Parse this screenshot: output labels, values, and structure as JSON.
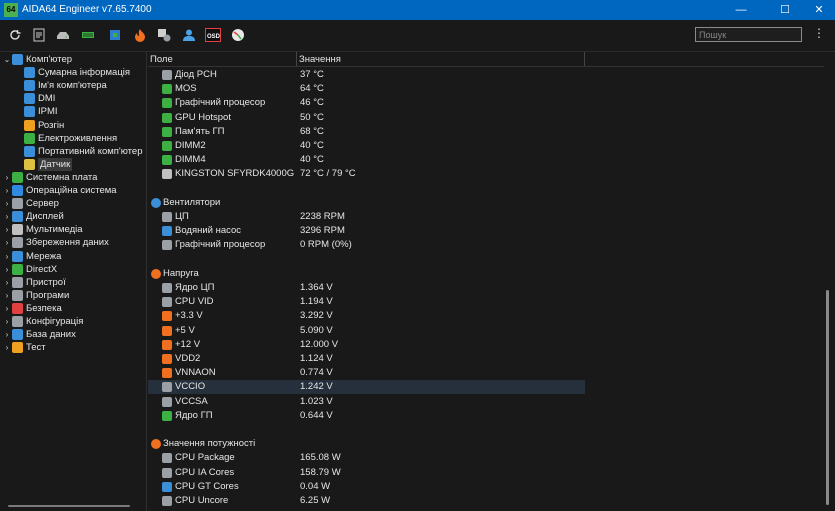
{
  "window": {
    "title": "AIDA64 Engineer v7.65.7400",
    "app_icon": "64"
  },
  "toolbar": {
    "search_placeholder": "Пошук",
    "kebab": "⋮"
  },
  "tree": {
    "items": [
      {
        "label": "Комп'ютер",
        "level": 0,
        "expanded": true,
        "icon": "computer-icon",
        "color": "#3b8fd9"
      },
      {
        "label": "Сумарна інформація",
        "level": 1,
        "icon": "summary-icon",
        "color": "#3b8fd9"
      },
      {
        "label": "Ім'я комп'ютера",
        "level": 1,
        "icon": "computer-name-icon",
        "color": "#3b8fd9"
      },
      {
        "label": "DMI",
        "level": 1,
        "icon": "dmi-icon",
        "color": "#3b8fd9"
      },
      {
        "label": "IPMI",
        "level": 1,
        "icon": "ipmi-icon",
        "color": "#3b8fd9"
      },
      {
        "label": "Розгін",
        "level": 1,
        "icon": "overclock-icon",
        "color": "#f0a020"
      },
      {
        "label": "Електроживлення",
        "level": 1,
        "icon": "power-icon",
        "color": "#3cb043"
      },
      {
        "label": "Портативний комп'ютер",
        "level": 1,
        "icon": "laptop-icon",
        "color": "#3b8fd9"
      },
      {
        "label": "Датчик",
        "level": 1,
        "icon": "sensor-icon",
        "color": "#e0c040",
        "selected": true
      },
      {
        "label": "Системна плата",
        "level": 0,
        "icon": "motherboard-icon",
        "color": "#3cb043"
      },
      {
        "label": "Операційна система",
        "level": 0,
        "icon": "windows-icon",
        "color": "#2f8ae0"
      },
      {
        "label": "Сервер",
        "level": 0,
        "icon": "server-icon",
        "color": "#9aa0a6"
      },
      {
        "label": "Дисплей",
        "level": 0,
        "icon": "display-icon",
        "color": "#3b8fd9"
      },
      {
        "label": "Мультимедіа",
        "level": 0,
        "icon": "multimedia-icon",
        "color": "#c0c0c0"
      },
      {
        "label": "Збереження даних",
        "level": 0,
        "icon": "storage-icon",
        "color": "#9aa0a6"
      },
      {
        "label": "Мережа",
        "level": 0,
        "icon": "network-icon",
        "color": "#3b8fd9"
      },
      {
        "label": "DirectX",
        "level": 0,
        "icon": "directx-icon",
        "color": "#3cb043"
      },
      {
        "label": "Пристрої",
        "level": 0,
        "icon": "devices-icon",
        "color": "#9aa0a6"
      },
      {
        "label": "Програми",
        "level": 0,
        "icon": "programs-icon",
        "color": "#9aa0a6"
      },
      {
        "label": "Безпека",
        "level": 0,
        "icon": "security-icon",
        "color": "#e04040"
      },
      {
        "label": "Конфігурація",
        "level": 0,
        "icon": "config-icon",
        "color": "#9aa0a6"
      },
      {
        "label": "База даних",
        "level": 0,
        "icon": "database-icon",
        "color": "#3b8fd9"
      },
      {
        "label": "Тест",
        "level": 0,
        "icon": "test-icon",
        "color": "#f0a020"
      }
    ]
  },
  "list": {
    "col_field": "Поле",
    "col_value": "Значення",
    "rows": [
      {
        "kind": "item",
        "name": "Діод PCH",
        "value": "37 °C",
        "icon": "pch-icon",
        "color": "#9aa0a6"
      },
      {
        "kind": "item",
        "name": "MOS",
        "value": "64 °C",
        "icon": "mos-icon",
        "color": "#3cb043"
      },
      {
        "kind": "item",
        "name": "Графічний процесор",
        "value": "46 °C",
        "icon": "gpu-icon",
        "color": "#3cb043"
      },
      {
        "kind": "item",
        "name": "GPU Hotspot",
        "value": "50 °C",
        "icon": "gpu-hotspot-icon",
        "color": "#3cb043"
      },
      {
        "kind": "item",
        "name": "Пам'ять ГП",
        "value": "68 °C",
        "icon": "gpu-memory-icon",
        "color": "#3cb043"
      },
      {
        "kind": "item",
        "name": "DIMM2",
        "value": "40 °C",
        "icon": "dimm-icon",
        "color": "#3cb043"
      },
      {
        "kind": "item",
        "name": "DIMM4",
        "value": "40 °C",
        "icon": "dimm-icon",
        "color": "#3cb043"
      },
      {
        "kind": "item",
        "name": "KINGSTON SFYRDK4000G",
        "value": "72 °C / 79 °C",
        "icon": "ssd-icon",
        "color": "#c0c0c0"
      },
      {
        "kind": "blank"
      },
      {
        "kind": "section",
        "name": "Вентилятори",
        "icon": "fan-section-icon",
        "color": "#3b8fd9"
      },
      {
        "kind": "item",
        "name": "ЦП",
        "value": "2238 RPM",
        "icon": "cpu-fan-icon",
        "color": "#9aa0a6"
      },
      {
        "kind": "item",
        "name": "Водяний насос",
        "value": "3296 RPM",
        "icon": "pump-icon",
        "color": "#3b8fd9"
      },
      {
        "kind": "item",
        "name": "Графічний процесор",
        "value": "0 RPM  (0%)",
        "icon": "gpu-fan-icon",
        "color": "#9aa0a6"
      },
      {
        "kind": "blank"
      },
      {
        "kind": "section",
        "name": "Напруга",
        "icon": "voltage-section-icon",
        "color": "#f07020"
      },
      {
        "kind": "item",
        "name": "Ядро ЦП",
        "value": "1.364 V",
        "icon": "cpu-core-icon",
        "color": "#9aa0a6"
      },
      {
        "kind": "item",
        "name": "CPU VID",
        "value": "1.194 V",
        "icon": "cpu-vid-icon",
        "color": "#9aa0a6"
      },
      {
        "kind": "item",
        "name": "+3.3 V",
        "value": "3.292 V",
        "icon": "voltage-icon",
        "color": "#f07020"
      },
      {
        "kind": "item",
        "name": "+5 V",
        "value": "5.090 V",
        "icon": "voltage-icon",
        "color": "#f07020"
      },
      {
        "kind": "item",
        "name": "+12 V",
        "value": "12.000 V",
        "icon": "voltage-icon",
        "color": "#f07020"
      },
      {
        "kind": "item",
        "name": "VDD2",
        "value": "1.124 V",
        "icon": "voltage-icon",
        "color": "#f07020"
      },
      {
        "kind": "item",
        "name": "VNNAON",
        "value": "0.774 V",
        "icon": "voltage-icon",
        "color": "#f07020"
      },
      {
        "kind": "item",
        "name": "VCCIO",
        "value": "1.242 V",
        "icon": "vccio-icon",
        "color": "#9aa0a6",
        "highlight": true
      },
      {
        "kind": "item",
        "name": "VCCSA",
        "value": "1.023 V",
        "icon": "vccsa-icon",
        "color": "#9aa0a6"
      },
      {
        "kind": "item",
        "name": "Ядро ГП",
        "value": "0.644 V",
        "icon": "gpu-core-icon",
        "color": "#3cb043"
      },
      {
        "kind": "blank"
      },
      {
        "kind": "section",
        "name": "Значення потужності",
        "icon": "power-section-icon",
        "color": "#f07020"
      },
      {
        "kind": "item",
        "name": "CPU Package",
        "value": "165.08 W",
        "icon": "cpu-package-icon",
        "color": "#9aa0a6"
      },
      {
        "kind": "item",
        "name": "CPU IA Cores",
        "value": "158.79 W",
        "icon": "cpu-ia-icon",
        "color": "#9aa0a6"
      },
      {
        "kind": "item",
        "name": "CPU GT Cores",
        "value": "0.04 W",
        "icon": "cpu-gt-icon",
        "color": "#3b8fd9"
      },
      {
        "kind": "item",
        "name": "CPU Uncore",
        "value": "6.25 W",
        "icon": "cpu-uncore-icon",
        "color": "#9aa0a6"
      }
    ]
  }
}
